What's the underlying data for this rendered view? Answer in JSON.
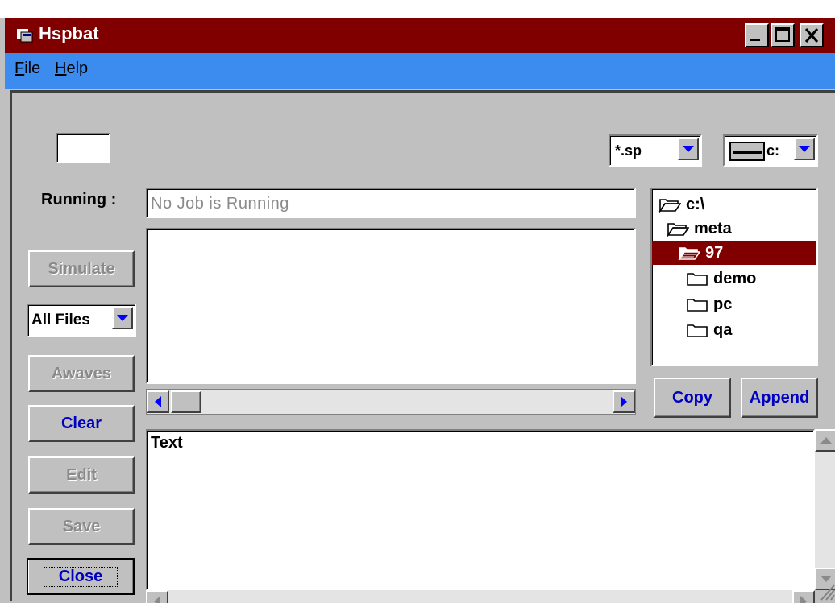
{
  "window": {
    "title": "Hspbat"
  },
  "menu": {
    "file": "File",
    "help": "Help"
  },
  "running": {
    "label": "Running :",
    "status": "No Job is Running"
  },
  "buttons": {
    "simulate": "Simulate",
    "awaves": "Awaves",
    "clear": "Clear",
    "edit": "Edit",
    "save": "Save",
    "close": "Close",
    "copy": "Copy",
    "append": "Append"
  },
  "filter_select": {
    "value": "All Files"
  },
  "pattern_select": {
    "value": "*.sp"
  },
  "drive_select": {
    "value": "c:"
  },
  "directory_tree": [
    {
      "name": "c:\\",
      "indent": 0,
      "state": "open",
      "selected": false
    },
    {
      "name": "meta",
      "indent": 1,
      "state": "open",
      "selected": false
    },
    {
      "name": "97",
      "indent": 2,
      "state": "open",
      "selected": true
    },
    {
      "name": "demo",
      "indent": 3,
      "state": "closed",
      "selected": false
    },
    {
      "name": "pc",
      "indent": 3,
      "state": "closed",
      "selected": false
    },
    {
      "name": "qa",
      "indent": 3,
      "state": "closed",
      "selected": false
    }
  ],
  "output": {
    "text": "Text"
  },
  "colors": {
    "title_bar": "#800000",
    "menu_bar": "#3c8cf0",
    "face": "#c0c0c0",
    "enabled_text": "#0000c0",
    "disabled_text": "#8a8a8a"
  }
}
